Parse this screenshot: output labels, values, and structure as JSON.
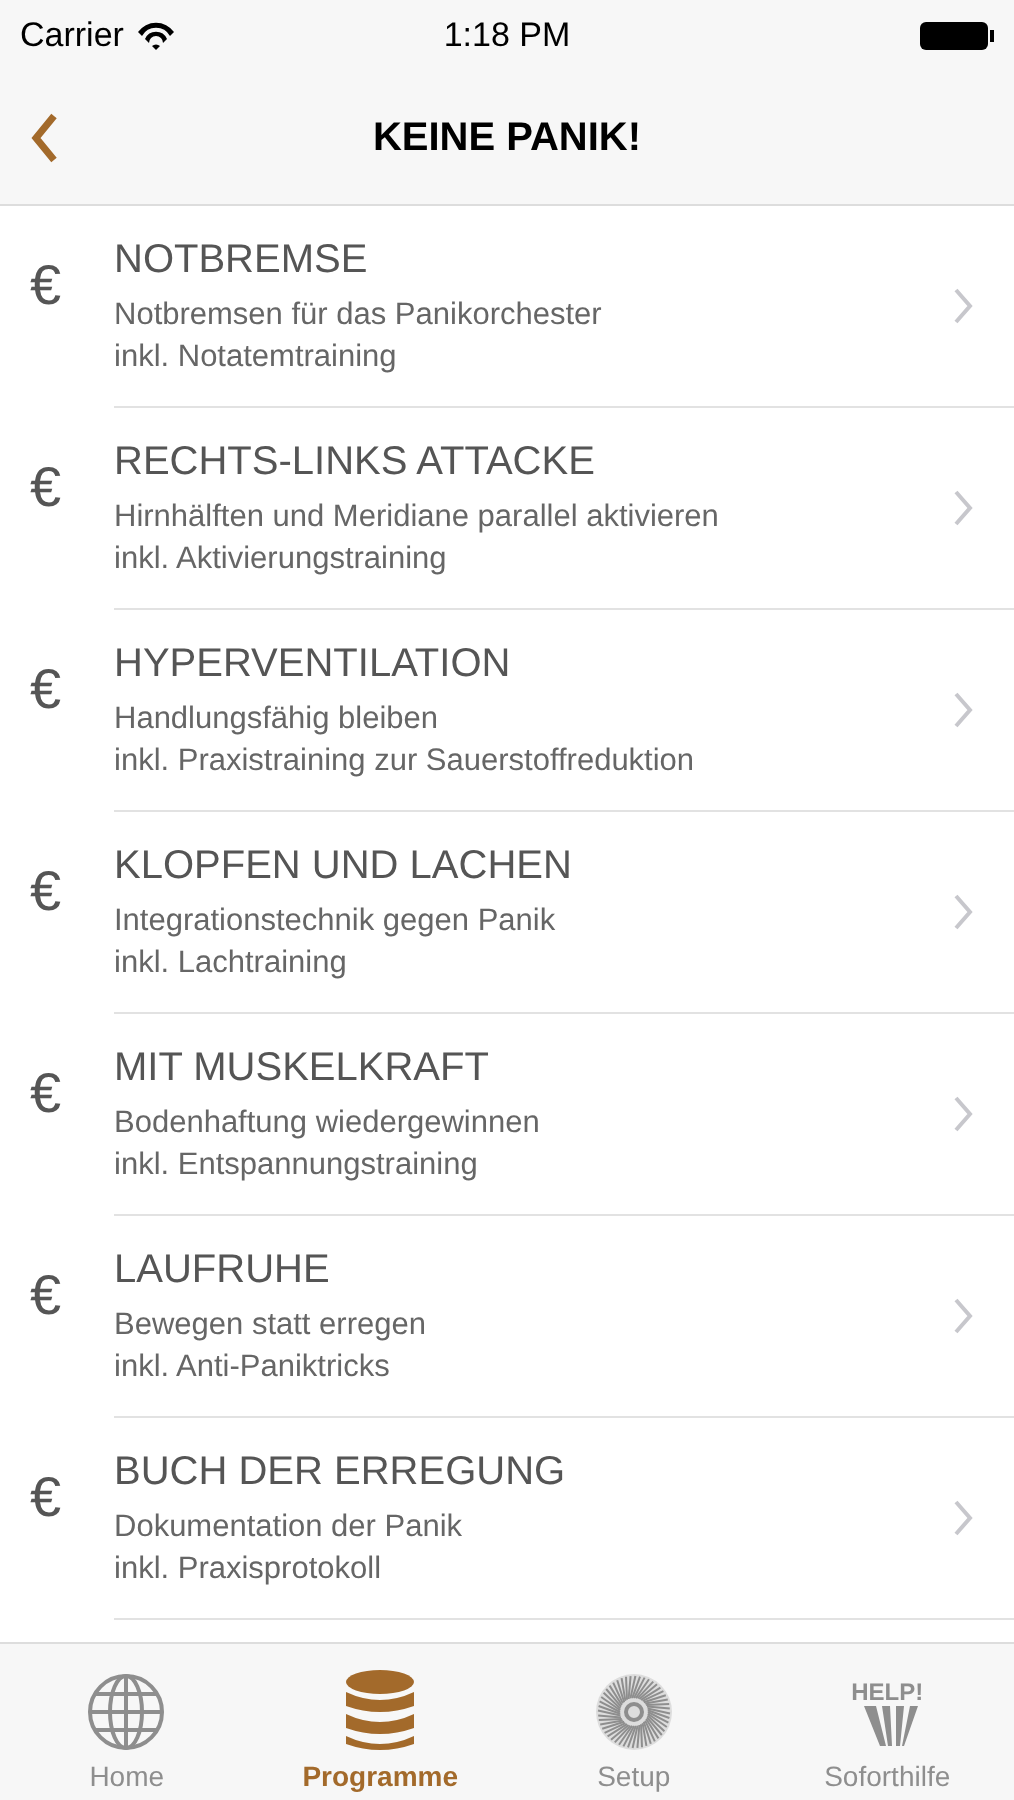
{
  "status_bar": {
    "carrier": "Carrier",
    "time": "1:18 PM"
  },
  "nav": {
    "title": "KEINE PANIK!"
  },
  "items": [
    {
      "symbol": "€",
      "title": "NOTBREMSE",
      "lines": [
        "Notbremsen für das Panikorchester",
        "inkl. Notatemtraining"
      ]
    },
    {
      "symbol": "€",
      "title": "RECHTS-LINKS ATTACKE",
      "lines": [
        "Hirnhälften und Meridiane parallel aktivieren",
        "inkl. Aktivierungstraining"
      ]
    },
    {
      "symbol": "€",
      "title": "HYPERVENTILATION",
      "lines": [
        "Handlungsfähig bleiben",
        "inkl. Praxistraining zur Sauerstoffreduktion"
      ]
    },
    {
      "symbol": "€",
      "title": "KLOPFEN UND LACHEN",
      "lines": [
        "Integrationstechnik gegen Panik",
        "inkl. Lachtraining"
      ]
    },
    {
      "symbol": "€",
      "title": "MIT MUSKELKRAFT",
      "lines": [
        "Bodenhaftung wiedergewinnen",
        "inkl. Entspannungstraining"
      ]
    },
    {
      "symbol": "€",
      "title": "LAUFRUHE",
      "lines": [
        "Bewegen statt erregen",
        "inkl. Anti-Paniktricks"
      ]
    },
    {
      "symbol": "€",
      "title": "BUCH DER ERREGUNG",
      "lines": [
        "Dokumentation der Panik",
        "inkl. Praxisprotokoll"
      ]
    }
  ],
  "tabs": [
    {
      "kind": "globe",
      "label": "Home",
      "selected": false
    },
    {
      "kind": "database",
      "label": "Programme",
      "selected": true
    },
    {
      "kind": "dial",
      "label": "Setup",
      "selected": false
    },
    {
      "kind": "help",
      "label": "Soforthilfe",
      "selected": false,
      "icon_text": "HELP!"
    }
  ]
}
